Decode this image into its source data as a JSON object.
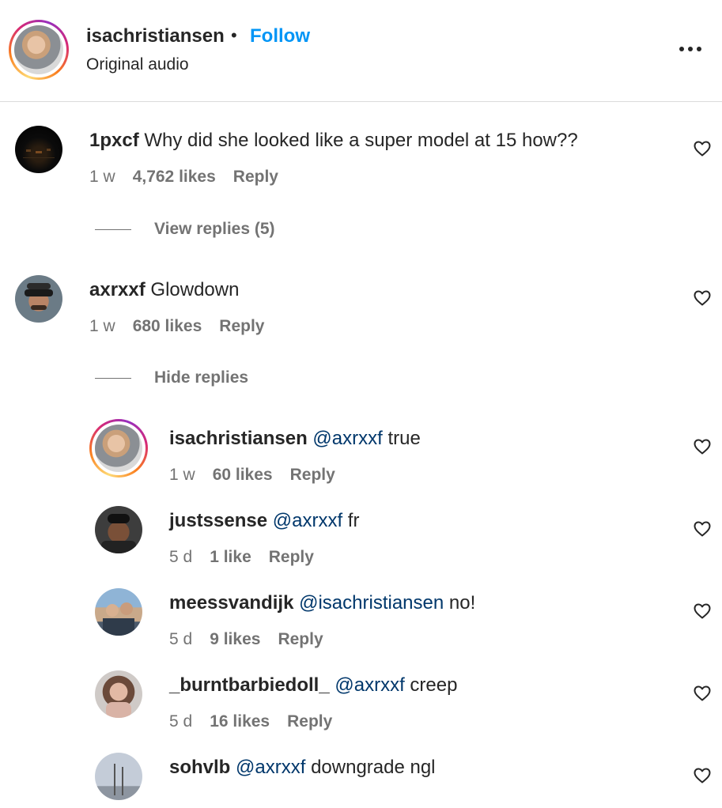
{
  "header": {
    "username": "isachristiansen",
    "separator": "•",
    "follow_label": "Follow",
    "audio": "Original audio"
  },
  "comments": [
    {
      "username": "1pxcf",
      "text": "Why did she looked like a super model at 15 how??",
      "time": "1 w",
      "likes": "4,762 likes",
      "reply_label": "Reply",
      "replies_toggle": "View replies (5)"
    },
    {
      "username": "axrxxf",
      "text": "Glowdown",
      "time": "1 w",
      "likes": "680 likes",
      "reply_label": "Reply",
      "replies_toggle": "Hide replies"
    }
  ],
  "replies": [
    {
      "username": "isachristiansen",
      "mention": "@axrxxf",
      "text": "true",
      "time": "1 w",
      "likes": "60 likes",
      "reply_label": "Reply"
    },
    {
      "username": "justssense",
      "mention": "@axrxxf",
      "text": "fr",
      "time": "5 d",
      "likes": "1 like",
      "reply_label": "Reply"
    },
    {
      "username": "meessvandijk",
      "mention": "@isachristiansen",
      "text": "no!",
      "time": "5 d",
      "likes": "9 likes",
      "reply_label": "Reply"
    },
    {
      "username": "_burntbarbiedoll_",
      "mention": "@axrxxf",
      "text": "creep",
      "time": "5 d",
      "likes": "16 likes",
      "reply_label": "Reply"
    },
    {
      "username": "sohvlb",
      "mention": "@axrxxf",
      "text": "downgrade ngl",
      "time": "",
      "likes": "",
      "reply_label": ""
    }
  ],
  "colors": {
    "follow": "#0095f6",
    "mention": "#00376b",
    "muted": "#737373",
    "text": "#262626"
  },
  "icons": [
    "more-icon",
    "heart-icon"
  ]
}
